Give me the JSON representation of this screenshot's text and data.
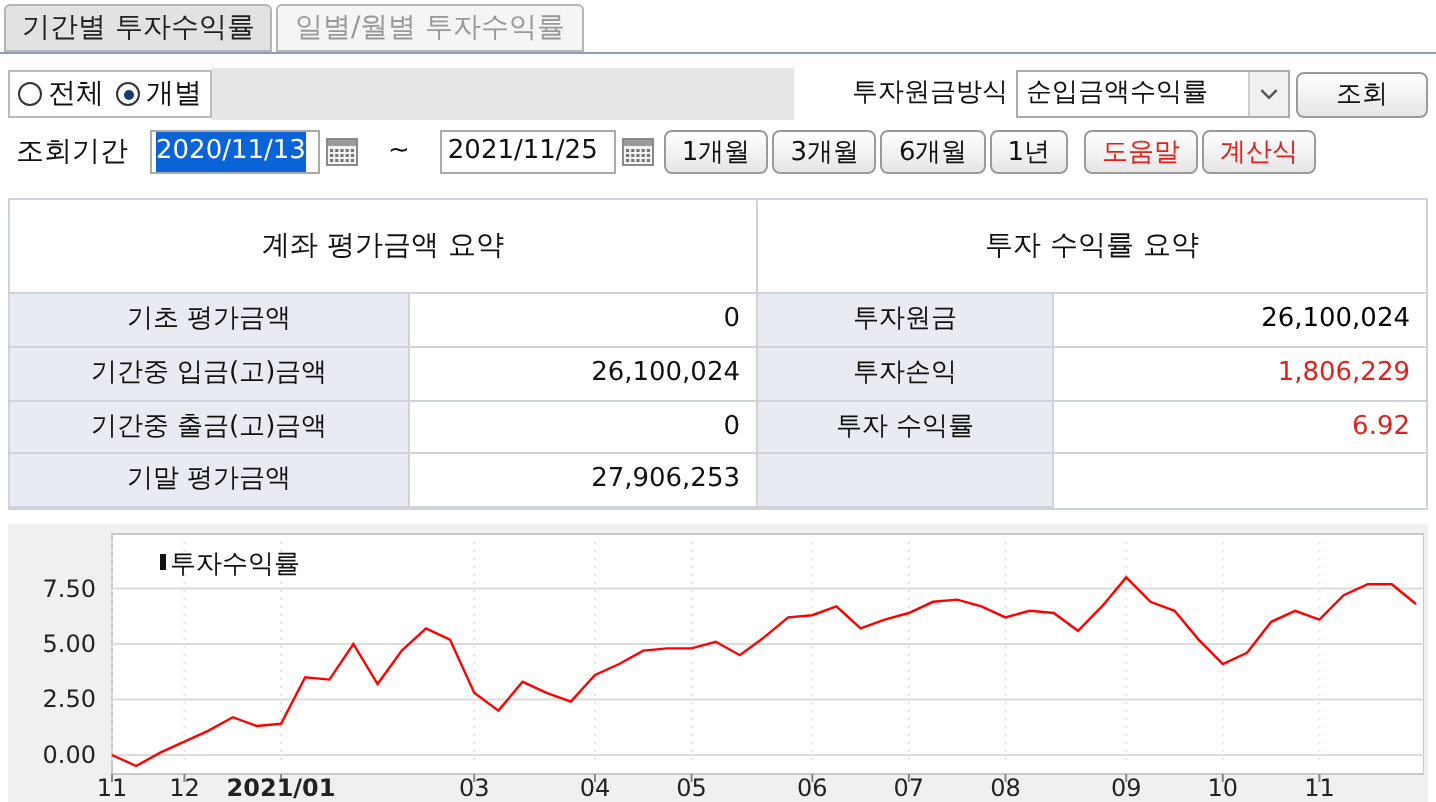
{
  "tabs": [
    {
      "label": "기간별 투자수익률",
      "selected": true
    },
    {
      "label": "일별/월별 투자수익률",
      "selected": false
    }
  ],
  "scope": [
    {
      "label": "전체",
      "selected": false
    },
    {
      "label": "개별",
      "selected": true
    }
  ],
  "principal_method": {
    "label": "투자원금방식",
    "value": "순입금액수익률"
  },
  "search_button": "조회",
  "period": {
    "label": "조회기간",
    "from": "2020/11/13",
    "separator": "~",
    "to": "2021/11/25"
  },
  "period_buttons": [
    {
      "label": "1개월",
      "kind": "plain"
    },
    {
      "label": "3개월",
      "kind": "plain"
    },
    {
      "label": "6개월",
      "kind": "plain"
    },
    {
      "label": "1년",
      "kind": "plain"
    },
    {
      "label": "도움말",
      "kind": "accent"
    },
    {
      "label": "계산식",
      "kind": "accent"
    }
  ],
  "account_summary": {
    "title": "계좌 평가금액 요약",
    "rows": [
      {
        "label": "기초 평가금액",
        "value": "0"
      },
      {
        "label": "기간중 입금(고)금액",
        "value": "26,100,024"
      },
      {
        "label": "기간중 출금(고)금액",
        "value": "0"
      },
      {
        "label": "기말 평가금액",
        "value": "27,906,253"
      }
    ]
  },
  "return_summary": {
    "title": "투자 수익률 요약",
    "rows": [
      {
        "label": "투자원금",
        "value": "26,100,024",
        "color": "#000000"
      },
      {
        "label": "투자손익",
        "value": "1,806,229",
        "color": "#e0201c"
      },
      {
        "label": "투자 수익률",
        "value": "6.92",
        "color": "#e0201c"
      }
    ]
  },
  "chart": {
    "chart_data": {
      "type": "line",
      "categories": [
        "11",
        null,
        null,
        "12",
        null,
        null,
        null,
        "2021/01",
        null,
        null,
        null,
        null,
        null,
        null,
        null,
        "03",
        null,
        null,
        null,
        null,
        "04",
        null,
        null,
        null,
        "05",
        null,
        null,
        null,
        null,
        "06",
        null,
        null,
        null,
        "07",
        null,
        null,
        null,
        "08",
        null,
        null,
        null,
        null,
        "09",
        null,
        null,
        null,
        "10",
        null,
        null,
        null,
        "11",
        null,
        null,
        null,
        null
      ],
      "series": [
        {
          "name": "투자수익률",
          "color": "#ff0000",
          "values": [
            0,
            -0.5,
            0.1,
            0.6,
            1.1,
            1.7,
            1.3,
            1.4,
            3.5,
            3.4,
            5.0,
            3.2,
            4.7,
            5.7,
            5.2,
            2.8,
            2.0,
            3.3,
            2.8,
            2.4,
            3.6,
            4.1,
            4.7,
            4.8,
            4.8,
            5.1,
            4.5,
            5.3,
            6.2,
            6.3,
            6.7,
            5.7,
            6.1,
            6.4,
            6.9,
            7.0,
            6.7,
            6.2,
            6.5,
            6.4,
            5.6,
            6.7,
            8.0,
            6.9,
            6.5,
            5.2,
            4.1,
            4.6,
            6.0,
            6.5,
            6.1,
            7.2,
            7.7,
            7.7,
            6.8
          ]
        }
      ],
      "grid": true,
      "ylim": [
        -0.5,
        9.6
      ],
      "yticks": [
        {
          "value": 0,
          "label": "0.00"
        },
        {
          "value": 2.5,
          "label": "2.50"
        },
        {
          "value": 5,
          "label": "5.00"
        },
        {
          "value": 7.5,
          "label": "7.50"
        }
      ]
    }
  }
}
